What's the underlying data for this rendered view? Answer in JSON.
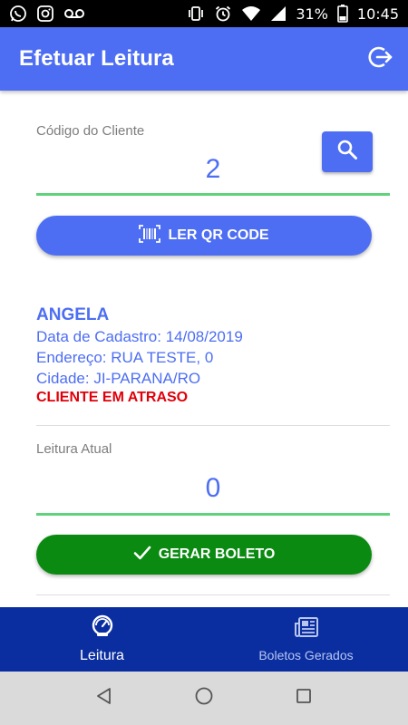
{
  "status_bar": {
    "left_icons": [
      "whatsapp-icon",
      "instagram-icon",
      "voicemail-icon"
    ],
    "right_icons": [
      "vibrate-icon",
      "alarm-icon",
      "wifi-icon",
      "signal-icon",
      "battery-icon"
    ],
    "battery": "31%",
    "time": "10:45"
  },
  "app_bar": {
    "title": "Efetuar Leitura",
    "logout_icon": "logout-icon"
  },
  "client_code": {
    "label": "Código do Cliente",
    "value": "2",
    "search_icon": "search-icon"
  },
  "qr_button": {
    "label": "LER QR CODE",
    "icon": "barcode-icon"
  },
  "client": {
    "name": "ANGELA",
    "registration": "Data de Cadastro: 14/08/2019",
    "address": "Endereço: RUA TESTE, 0",
    "city": "Cidade: JI-PARANA/RO",
    "status": "CLIENTE EM ATRASO"
  },
  "reading": {
    "label": "Leitura Atual",
    "value": "0"
  },
  "generate_button": {
    "label": "GERAR BOLETO",
    "icon": "check-icon"
  },
  "bottom_nav": {
    "items": [
      {
        "label": "Leitura",
        "icon": "speedometer-icon",
        "active": true
      },
      {
        "label": "Boletos Gerados",
        "icon": "newspaper-icon",
        "active": false
      }
    ]
  },
  "system_nav": [
    "back-icon",
    "home-icon",
    "recents-icon"
  ],
  "colors": {
    "primary": "#4d6ef3",
    "success": "#0a8a10",
    "danger": "#e0000a",
    "underline": "#5fd27b",
    "nav_background": "#0a2ea0"
  }
}
